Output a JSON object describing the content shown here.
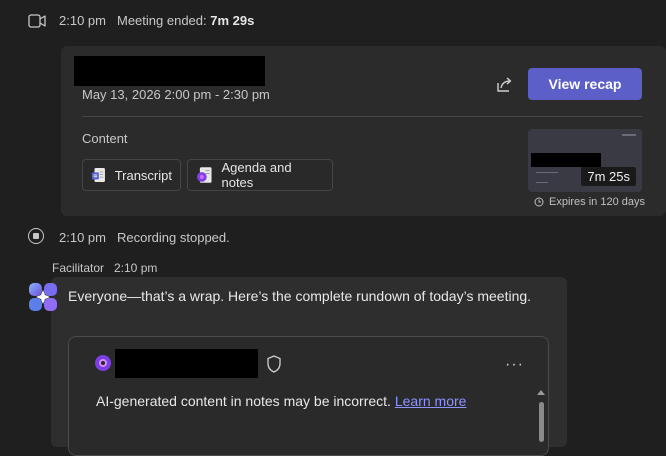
{
  "meeting_ended": {
    "time": "2:10 pm",
    "text": "Meeting ended:",
    "duration": "7m 29s"
  },
  "card": {
    "date": "May 13, 2026 2:00 pm - 2:30 pm",
    "recap_button": "View recap",
    "content_label": "Content",
    "chips": [
      {
        "label": "Transcript"
      },
      {
        "label": "Agenda and notes"
      }
    ],
    "recording_duration": "7m 25s",
    "expires": "Expires in 120 days"
  },
  "recording_stopped": {
    "time": "2:10 pm",
    "text": "Recording stopped."
  },
  "facilitator": {
    "name": "Facilitator",
    "time": "2:10 pm",
    "message": "Everyone—that’s a wrap. Here’s the complete rundown of today’s meeting.",
    "ai_note": "AI-generated content in notes may be incorrect.",
    "learn_more": "Learn more",
    "more_label": "···"
  },
  "colors": {
    "accent": "#5b5fc7",
    "link": "#8f93ff",
    "background": "#1f1f1f",
    "card": "#2b2b2b"
  }
}
